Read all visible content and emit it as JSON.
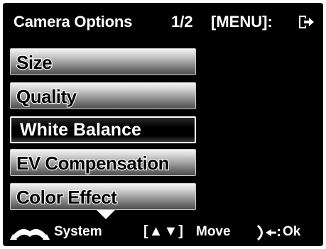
{
  "header": {
    "title": "Camera Options",
    "page": "1/2",
    "menu_hint": "[MENU]:",
    "menu_icon": "exit-icon"
  },
  "menu": {
    "items": [
      {
        "label": "Size"
      },
      {
        "label": "Quality"
      },
      {
        "label": "White Balance",
        "selected": true
      },
      {
        "label": "EV Compensation"
      },
      {
        "label": "Color Effect"
      }
    ]
  },
  "footer": {
    "system_icon": "system-tab-icon",
    "system_label": "System",
    "nav_keys": "[▲▼]",
    "move_label": "Move",
    "ok_icon": "enter-key-icon",
    "ok_label": "Ok",
    "scroll_icon": "scroll-down-arrow-icon"
  },
  "colors": {
    "background": "#000000",
    "text": "#ffffff",
    "item_gradient_top": "#f4f4f4",
    "item_gradient_bottom": "#4e4e4e",
    "selected_background": "#000000"
  }
}
